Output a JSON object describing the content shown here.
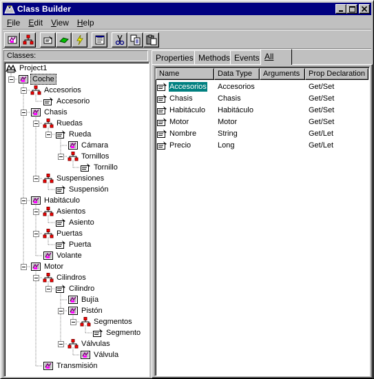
{
  "window": {
    "title": "Class Builder"
  },
  "menu": [
    {
      "label": "File",
      "accel": "F",
      "rest": "ile"
    },
    {
      "label": "Edit",
      "accel": "E",
      "rest": "dit"
    },
    {
      "label": "View",
      "accel": "V",
      "rest": "iew"
    },
    {
      "label": "Help",
      "accel": "H",
      "rest": "elp"
    }
  ],
  "toolbar": {
    "buttons": [
      {
        "name": "new-class-button",
        "icon": "class-icon"
      },
      {
        "name": "new-collection-button",
        "icon": "collection-icon"
      },
      {
        "name": "new-property-button",
        "icon": "property-icon"
      },
      {
        "name": "new-method-button",
        "icon": "method-icon"
      },
      {
        "name": "new-event-button",
        "icon": "event-icon"
      },
      {
        "name": "properties-button",
        "icon": "properties-icon"
      },
      {
        "name": "cut-button",
        "icon": "scissors-icon"
      },
      {
        "name": "copy-button",
        "icon": "copy-icon"
      },
      {
        "name": "paste-button",
        "icon": "paste-icon"
      }
    ]
  },
  "classes_pane": {
    "label": "Classes:",
    "tree": [
      {
        "label": "Project1",
        "icon": "project-icon",
        "depth": 0
      },
      {
        "label": "Coche",
        "icon": "class-icon",
        "depth": 1,
        "expanded": true,
        "selected": true
      },
      {
        "label": "Accesorios",
        "icon": "collection-icon",
        "depth": 2,
        "expanded": true
      },
      {
        "label": "Accesorio",
        "icon": "property-icon",
        "depth": 3
      },
      {
        "label": "Chasis",
        "icon": "class-icon",
        "depth": 2,
        "expanded": true
      },
      {
        "label": "Ruedas",
        "icon": "collection-icon",
        "depth": 3,
        "expanded": true
      },
      {
        "label": "Rueda",
        "icon": "property-icon",
        "depth": 4,
        "expanded": true
      },
      {
        "label": "Cámara",
        "icon": "class-icon",
        "depth": 5
      },
      {
        "label": "Tornillos",
        "icon": "collection-icon",
        "depth": 5,
        "expanded": true
      },
      {
        "label": "Tornillo",
        "icon": "property-icon",
        "depth": 6
      },
      {
        "label": "Suspensiones",
        "icon": "collection-icon",
        "depth": 3,
        "expanded": true
      },
      {
        "label": "Suspensión",
        "icon": "property-icon",
        "depth": 4
      },
      {
        "label": "Habitáculo",
        "icon": "class-icon",
        "depth": 2,
        "expanded": true
      },
      {
        "label": "Asientos",
        "icon": "collection-icon",
        "depth": 3,
        "expanded": true
      },
      {
        "label": "Asiento",
        "icon": "property-icon",
        "depth": 4
      },
      {
        "label": "Puertas",
        "icon": "collection-icon",
        "depth": 3,
        "expanded": true
      },
      {
        "label": "Puerta",
        "icon": "property-icon",
        "depth": 4
      },
      {
        "label": "Volante",
        "icon": "class-icon",
        "depth": 3
      },
      {
        "label": "Motor",
        "icon": "class-icon",
        "depth": 2,
        "expanded": true
      },
      {
        "label": "Cilindros",
        "icon": "collection-icon",
        "depth": 3,
        "expanded": true
      },
      {
        "label": "Cilindro",
        "icon": "property-icon",
        "depth": 4,
        "expanded": true
      },
      {
        "label": "Bujía",
        "icon": "class-icon",
        "depth": 5
      },
      {
        "label": "Pistón",
        "icon": "class-icon",
        "depth": 5,
        "expanded": true
      },
      {
        "label": "Segmentos",
        "icon": "collection-icon",
        "depth": 6,
        "expanded": true
      },
      {
        "label": "Segmento",
        "icon": "property-icon",
        "depth": 7
      },
      {
        "label": "Válvulas",
        "icon": "collection-icon",
        "depth": 5,
        "expanded": true
      },
      {
        "label": "Válvula",
        "icon": "class-icon",
        "depth": 6
      },
      {
        "label": "Transmisión",
        "icon": "class-icon",
        "depth": 3
      }
    ]
  },
  "tabs": [
    {
      "label": "Properties",
      "active": false
    },
    {
      "label": "Methods",
      "active": false
    },
    {
      "label": "Events",
      "active": false
    },
    {
      "label": "All",
      "active": true
    }
  ],
  "members_list": {
    "columns": [
      "Name",
      "Data Type",
      "Arguments",
      "Prop Declaration"
    ],
    "rows": [
      {
        "name": "Accesorios",
        "data_type": "Accesorios",
        "arguments": "",
        "declaration": "Get/Set",
        "selected": true
      },
      {
        "name": "Chasis",
        "data_type": "Chasis",
        "arguments": "",
        "declaration": "Get/Set"
      },
      {
        "name": "Habitáculo",
        "data_type": "Habitáculo",
        "arguments": "",
        "declaration": "Get/Set"
      },
      {
        "name": "Motor",
        "data_type": "Motor",
        "arguments": "",
        "declaration": "Get/Set"
      },
      {
        "name": "Nombre",
        "data_type": "String",
        "arguments": "",
        "declaration": "Get/Let"
      },
      {
        "name": "Precio",
        "data_type": "Long",
        "arguments": "",
        "declaration": "Get/Let"
      }
    ]
  }
}
